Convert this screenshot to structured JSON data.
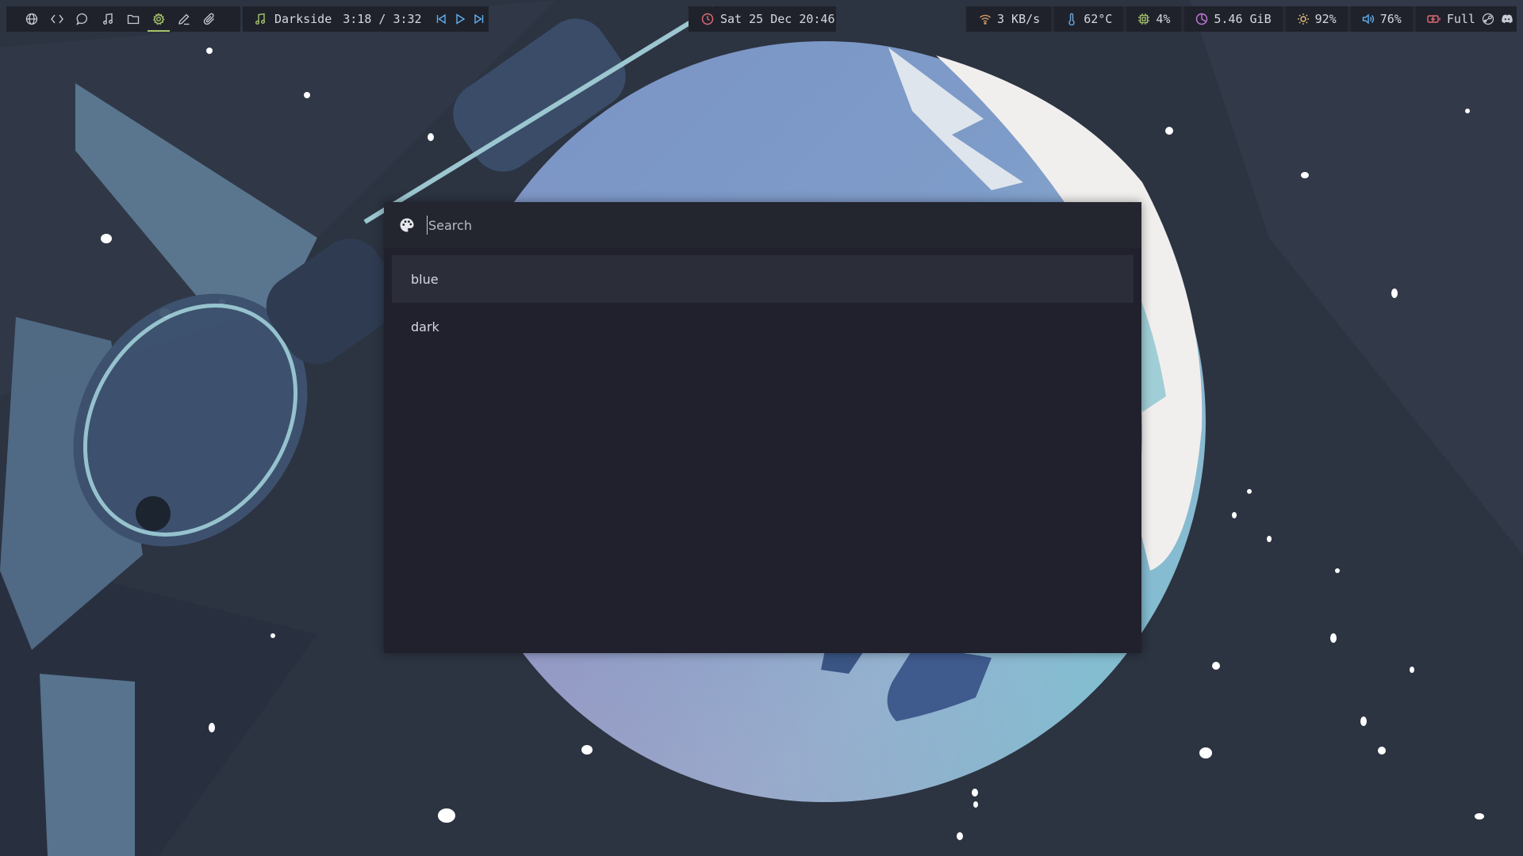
{
  "topbar": {
    "workspaces": [
      {
        "icon": "globe-icon",
        "active": false
      },
      {
        "icon": "code-icon",
        "active": false
      },
      {
        "icon": "chat-icon",
        "active": false
      },
      {
        "icon": "music-note-icon",
        "active": false
      },
      {
        "icon": "folder-icon",
        "active": false
      },
      {
        "icon": "gear-icon",
        "active": true
      },
      {
        "icon": "edit-icon",
        "active": false
      },
      {
        "icon": "paperclip-icon",
        "active": false
      }
    ],
    "music": {
      "track": "Darkside",
      "time": "3:18 / 3:32"
    },
    "clock": {
      "text": "Sat 25 Dec 20:46"
    },
    "stats": {
      "network": "3 KB/s",
      "temperature": "62°C",
      "cpu": "4%",
      "memory": "5.46 GiB",
      "brightness": "92%",
      "volume": "76%",
      "battery": "Full"
    }
  },
  "launcher": {
    "search_placeholder": "Search",
    "results": [
      "blue",
      "dark"
    ],
    "selected_index": 0
  },
  "colors": {
    "bar_bg": "#1f222b",
    "launcher_bg": "#20212c",
    "accent_green": "#a6c46b",
    "music_green": "#a6c46b",
    "clock_red": "#e06c75",
    "network_orange": "#d19a66",
    "temp_blue": "#6fa8dc",
    "cpu_green": "#a6c46b",
    "memory_purple": "#c678dd",
    "brightness_yellow": "#e5c07b",
    "volume_blue": "#61afef",
    "battery_red": "#e06c75"
  }
}
